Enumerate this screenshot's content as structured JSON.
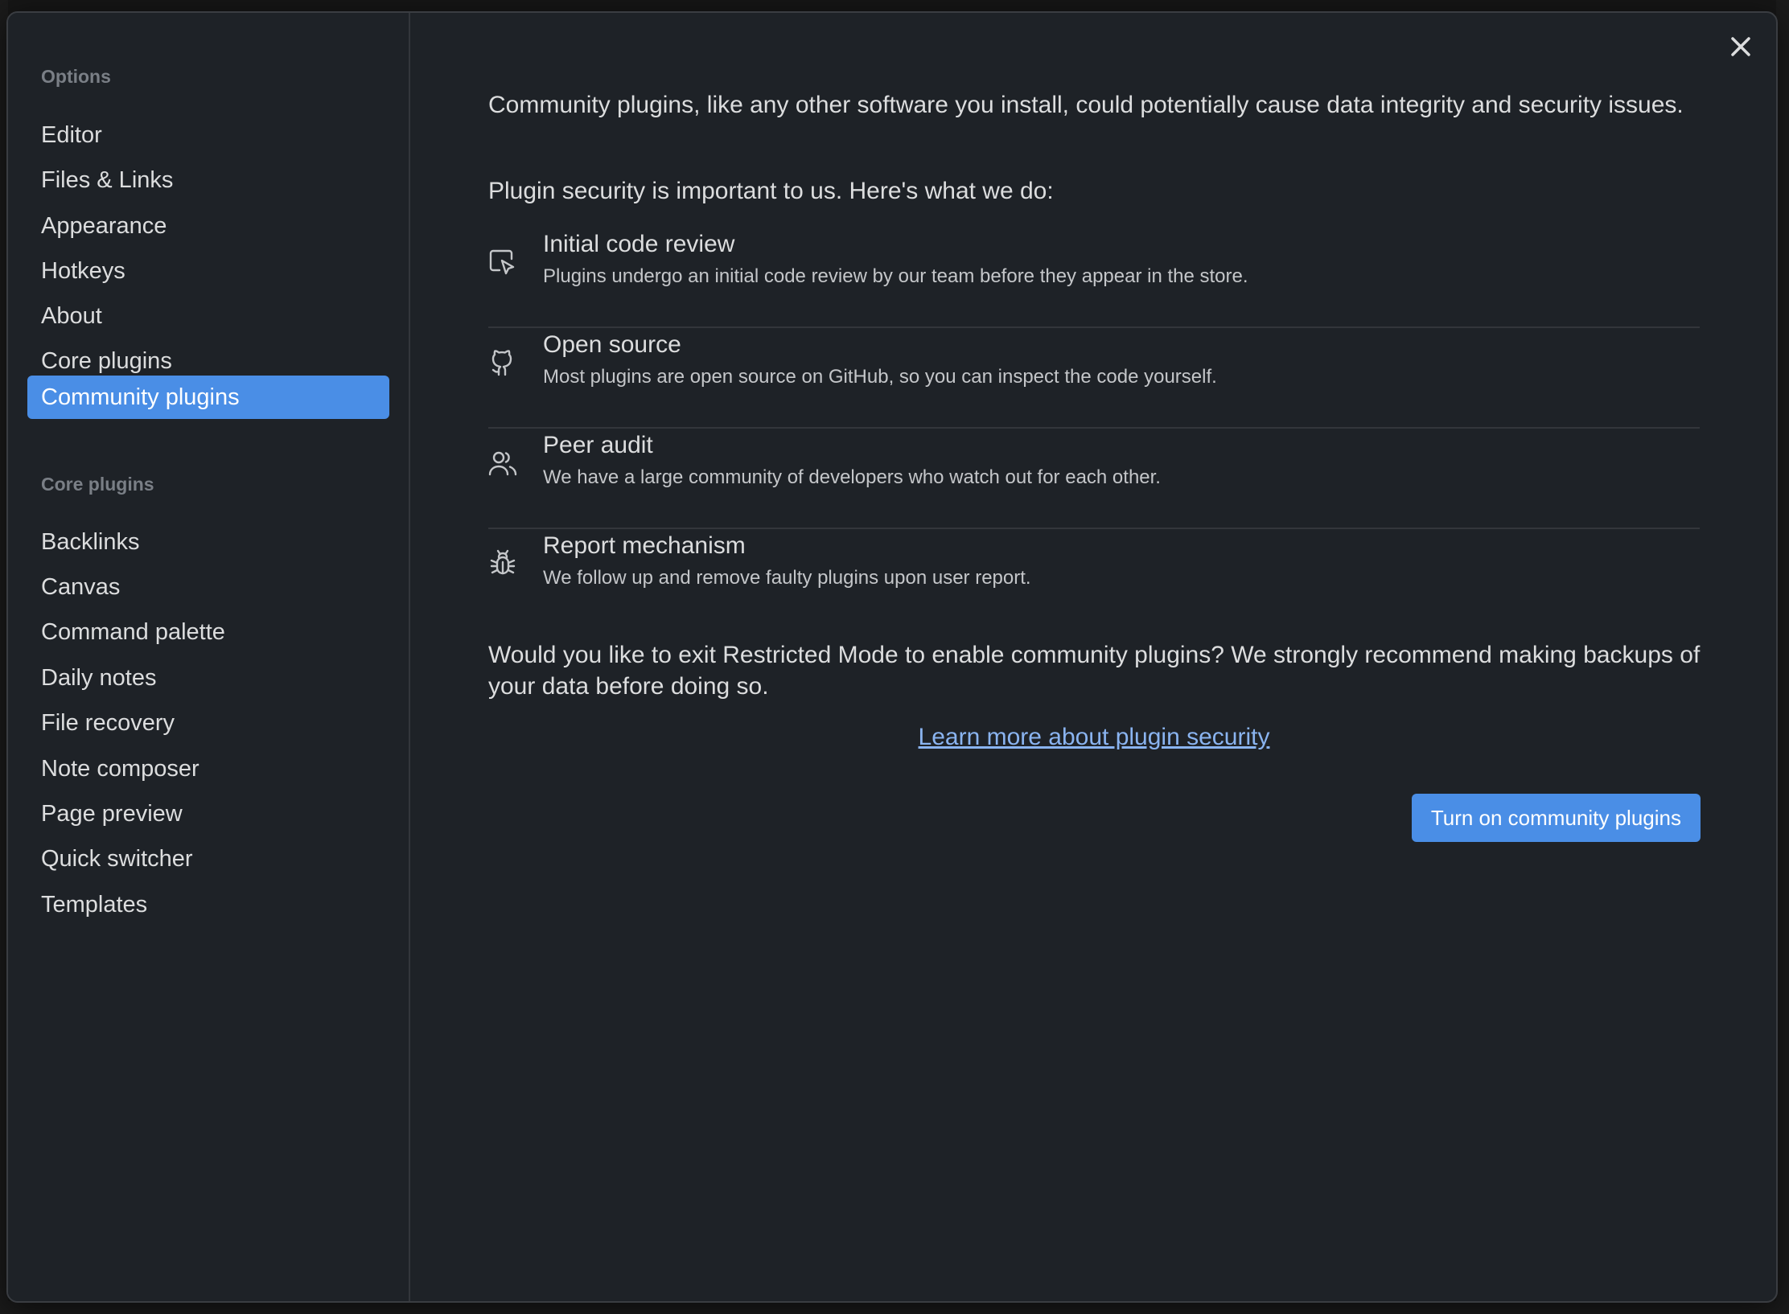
{
  "sidebar": {
    "options_title": "Options",
    "options_items": [
      {
        "label": "Editor"
      },
      {
        "label": "Files & Links"
      },
      {
        "label": "Appearance"
      },
      {
        "label": "Hotkeys"
      },
      {
        "label": "About"
      },
      {
        "label": "Core plugins"
      },
      {
        "label": "Community plugins"
      }
    ],
    "core_title": "Core plugins",
    "core_items": [
      {
        "label": "Backlinks"
      },
      {
        "label": "Canvas"
      },
      {
        "label": "Command palette"
      },
      {
        "label": "Daily notes"
      },
      {
        "label": "File recovery"
      },
      {
        "label": "Note composer"
      },
      {
        "label": "Page preview"
      },
      {
        "label": "Quick switcher"
      },
      {
        "label": "Templates"
      }
    ]
  },
  "main": {
    "intro": "Community plugins, like any other software you install, could potentially cause data integrity and security issues.",
    "security_heading": "Plugin security is important to us. Here's what we do:",
    "features": [
      {
        "icon": "code-review-icon",
        "title": "Initial code review",
        "description": "Plugins undergo an initial code review by our team before they appear in the store."
      },
      {
        "icon": "github-icon",
        "title": "Open source",
        "description": "Most plugins are open source on GitHub, so you can inspect the code yourself."
      },
      {
        "icon": "users-icon",
        "title": "Peer audit",
        "description": "We have a large community of developers who watch out for each other."
      },
      {
        "icon": "bug-icon",
        "title": "Report mechanism",
        "description": "We follow up and remove faulty plugins upon user report."
      }
    ],
    "question": "Would you like to exit Restricted Mode to enable community plugins? We strongly recommend making backups of your data before doing so.",
    "learn_more": "Learn more about plugin security",
    "turn_on_button": "Turn on community plugins"
  },
  "colors": {
    "accent": "#4a8ee6",
    "link": "#8ab4f0",
    "background": "#1e2227",
    "text": "#dcddde"
  }
}
